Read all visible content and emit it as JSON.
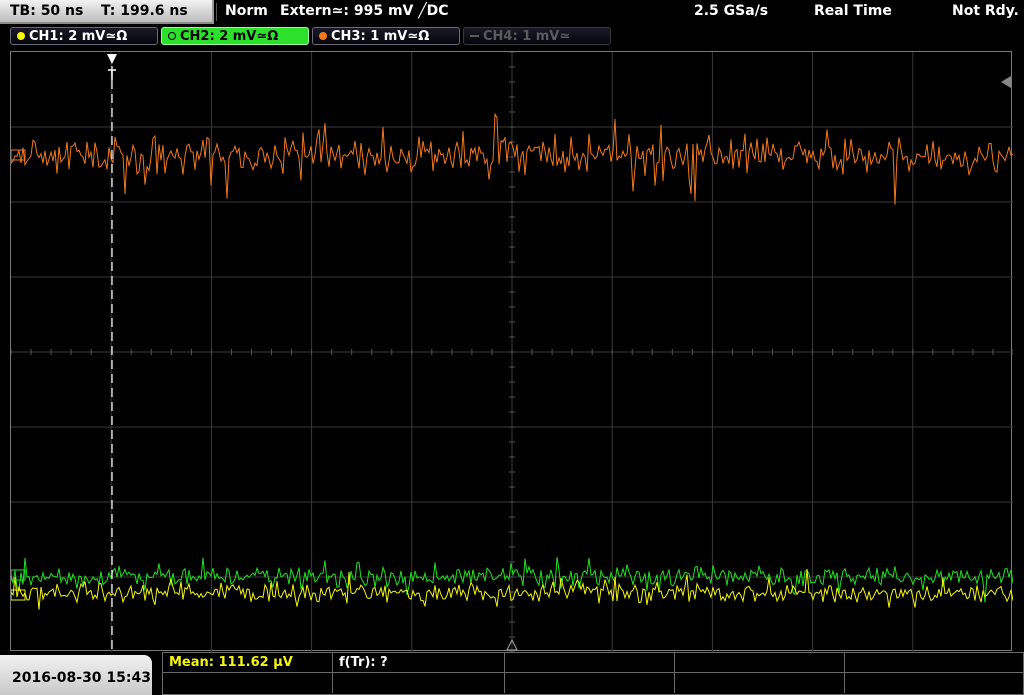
{
  "topbar": {
    "timebase": "TB: 50 ns",
    "trigger_pos": "T: 199.6 ns",
    "acq_mode": "Norm",
    "trigger_info": "Extern≃: 995 mV ╱DC",
    "sample_rate": "2.5 GSa/s",
    "mode": "Real Time",
    "status": "Not Rdy."
  },
  "channels": [
    {
      "label": "CH1: 2 mV≃Ω",
      "color": "#f5f510",
      "state": "on"
    },
    {
      "label": "CH2: 2 mV≃Ω",
      "color": "#22e022",
      "state": "active"
    },
    {
      "label": "CH3: 1 mV≃Ω",
      "color": "#f07820",
      "state": "on"
    },
    {
      "label": "CH4: 1 mV≃",
      "color": "#5a5a5a",
      "state": "off"
    }
  ],
  "colors": {
    "ch1": "#f5f510",
    "ch2": "#22e022",
    "ch3": "#f07820",
    "grid": "#3a3a3a"
  },
  "footer": {
    "datetime": "2016-08-30 15:43",
    "mean_label": "Mean: 111.62 µV",
    "freq_label": "f(Tr): ?"
  }
}
